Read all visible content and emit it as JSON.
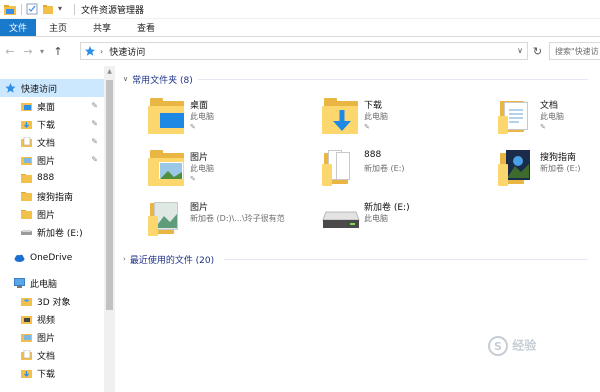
{
  "window": {
    "title": "文件资源管理器"
  },
  "ribbon": {
    "tabs": [
      "文件",
      "主页",
      "共享",
      "查看"
    ]
  },
  "address": {
    "path": "快速访问",
    "search_placeholder": "搜索\"快速访"
  },
  "nav": {
    "items": [
      {
        "label": "快速访问",
        "icon": "star-icon",
        "pinned": false,
        "level": 0,
        "selected": true
      },
      {
        "label": "桌面",
        "icon": "desktop-folder-icon",
        "pinned": true,
        "level": 1
      },
      {
        "label": "下载",
        "icon": "download-folder-icon",
        "pinned": true,
        "level": 1
      },
      {
        "label": "文档",
        "icon": "documents-folder-icon",
        "pinned": true,
        "level": 1
      },
      {
        "label": "图片",
        "icon": "pictures-folder-icon",
        "pinned": true,
        "level": 1
      },
      {
        "label": "888",
        "icon": "folder-icon",
        "pinned": false,
        "level": 1
      },
      {
        "label": "搜狗指南",
        "icon": "folder-icon",
        "pinned": false,
        "level": 1
      },
      {
        "label": "图片",
        "icon": "folder-icon",
        "pinned": false,
        "level": 1
      },
      {
        "label": "新加卷 (E:)",
        "icon": "drive-icon",
        "pinned": false,
        "level": 1
      },
      {
        "label": "OneDrive",
        "icon": "cloud-icon",
        "pinned": false,
        "level": 0
      },
      {
        "label": "此电脑",
        "icon": "computer-icon",
        "pinned": false,
        "level": 0
      },
      {
        "label": "3D 对象",
        "icon": "3d-objects-icon",
        "pinned": false,
        "level": 1
      },
      {
        "label": "视频",
        "icon": "videos-folder-icon",
        "pinned": false,
        "level": 1
      },
      {
        "label": "图片",
        "icon": "pictures-folder-icon",
        "pinned": false,
        "level": 1
      },
      {
        "label": "文档",
        "icon": "documents-folder-icon",
        "pinned": false,
        "level": 1
      },
      {
        "label": "下载",
        "icon": "download-folder-icon",
        "pinned": false,
        "level": 1
      }
    ]
  },
  "content": {
    "frequent_header": "常用文件夹 (8)",
    "recent_header": "最近使用的文件 (20)",
    "tiles": [
      {
        "name": "桌面",
        "sub": "此电脑",
        "pinned": true,
        "icon": "desktop-folder-icon"
      },
      {
        "name": "下载",
        "sub": "此电脑",
        "pinned": true,
        "icon": "download-folder-icon"
      },
      {
        "name": "文档",
        "sub": "此电脑",
        "pinned": true,
        "icon": "documents-folder-icon"
      },
      {
        "name": "图片",
        "sub": "此电脑",
        "pinned": true,
        "icon": "pictures-folder-icon"
      },
      {
        "name": "888",
        "sub": "新加卷 (E:)",
        "pinned": false,
        "icon": "folder-icon"
      },
      {
        "name": "搜狗指南",
        "sub": "新加卷 (E:)",
        "pinned": false,
        "icon": "folder-icon"
      },
      {
        "name": "图片",
        "sub": "新加卷 (D:)\\...\\玲子很有范",
        "pinned": false,
        "icon": "folder-icon"
      },
      {
        "name": "新加卷 (E:)",
        "sub": "此电脑",
        "pinned": false,
        "icon": "drive-icon"
      }
    ]
  },
  "colors": {
    "accent": "#1979ca",
    "selected": "#cce8ff",
    "group_text": "#1e3287",
    "folder": "#fcd76e"
  },
  "watermark": "经验"
}
